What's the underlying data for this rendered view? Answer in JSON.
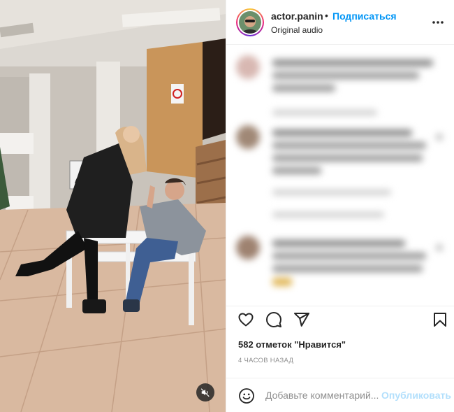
{
  "post": {
    "username": "actor.panin",
    "separator": "•",
    "follow_label": "Подписаться",
    "audio_label": "Original audio",
    "avatar_icon": "avatar",
    "more_icon": "more-horizontal-icon"
  },
  "media": {
    "mute_icon": "speaker-muted-icon"
  },
  "actions": {
    "like_icon": "heart-icon",
    "comment_icon": "comment-icon",
    "share_icon": "paper-plane-icon",
    "save_icon": "bookmark-icon"
  },
  "likes_text": "582 отметок \"Нравится\"",
  "time_text": "4 ЧАСОВ НАЗАД",
  "add_comment": {
    "placeholder": "Добавьте комментарий...",
    "post_label": "Опубликовать",
    "emoji_icon": "emoji-icon"
  },
  "colors": {
    "accent": "#0095f6",
    "post_disabled": "#b2dffc",
    "secondary_text": "#8e8e8e"
  }
}
